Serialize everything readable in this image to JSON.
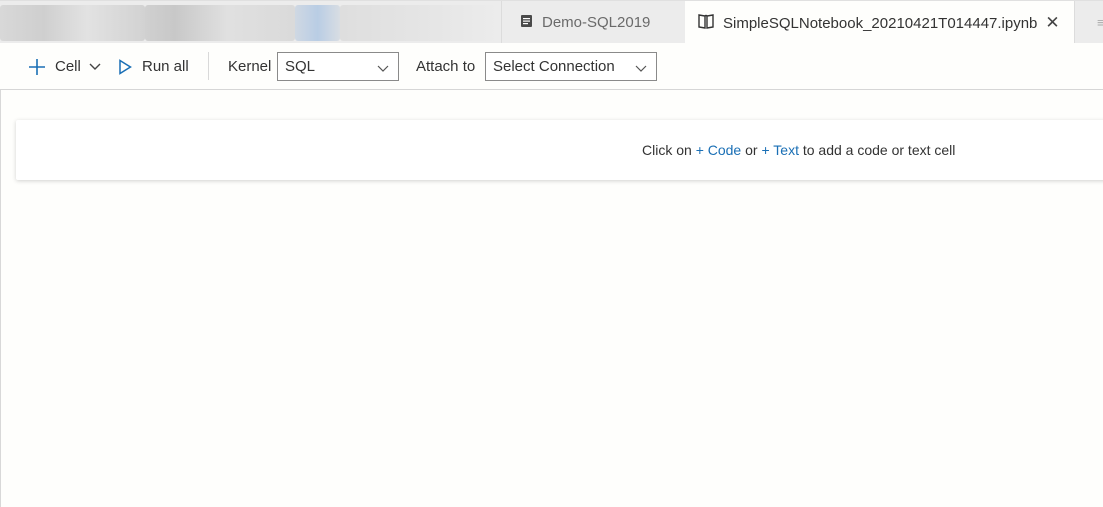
{
  "tabs": {
    "demo": {
      "label": "Demo-SQL2019",
      "icon": "sql-file-icon"
    },
    "notebook": {
      "label": "SimpleSQLNotebook_20210421T014447.ipynb",
      "icon": "notebook-icon",
      "close": "✕"
    },
    "more": {
      "glyph": "≡"
    }
  },
  "toolbar": {
    "cell_label": "Cell",
    "run_all_label": "Run all",
    "kernel_label": "Kernel",
    "kernel_value": "SQL",
    "attach_label": "Attach to",
    "attach_value": "Select Connection"
  },
  "notebook": {
    "hint_prefix": "Click on",
    "code_link": "+ Code",
    "or": "or",
    "text_link": "+ Text",
    "hint_suffix": "to add a code or text cell"
  },
  "colors": {
    "accent": "#1a6fb5",
    "tab_bar": "#ececec",
    "background": "#fefefc"
  }
}
